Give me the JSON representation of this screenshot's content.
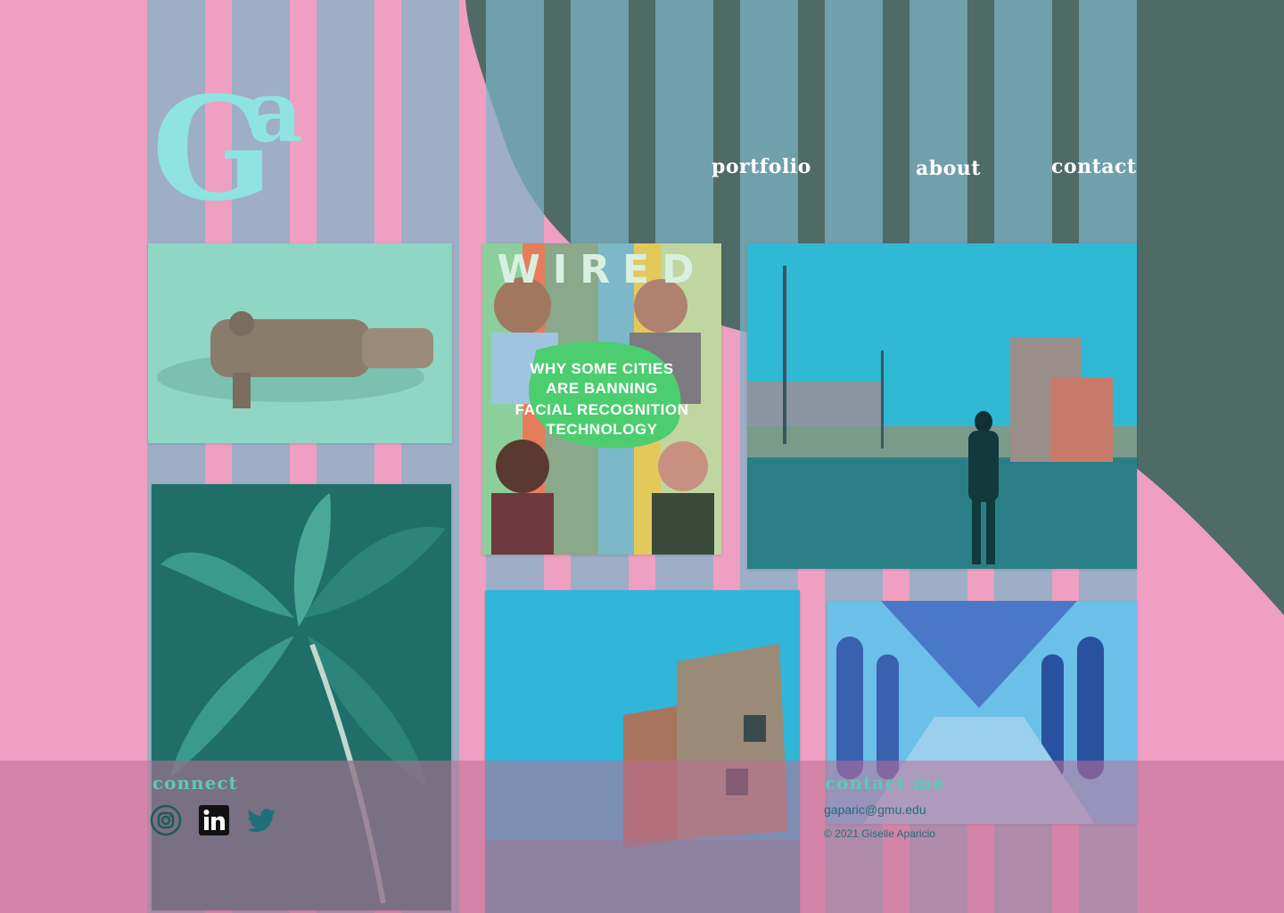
{
  "brand": {
    "logo_text": "Ga",
    "owner": "Giselle Aparicio"
  },
  "nav": {
    "items": [
      {
        "label": "portfolio"
      },
      {
        "label": "about"
      },
      {
        "label": "contact"
      }
    ]
  },
  "portfolio": {
    "tiles": [
      {
        "name": "metal-object-photo"
      },
      {
        "name": "wired-magazine-cover",
        "masthead": "WIRED",
        "headline_lines": [
          "WHY SOME CITIES",
          "ARE BANNING",
          "FACIAL RECOGNITION",
          "TECHNOLOGY"
        ]
      },
      {
        "name": "person-walking-photo"
      },
      {
        "name": "plant-leaves-photo"
      },
      {
        "name": "brick-building-photo"
      },
      {
        "name": "arched-corridor-illustration"
      }
    ]
  },
  "footer": {
    "connect_heading": "connect",
    "social": [
      {
        "icon": "instagram-icon"
      },
      {
        "icon": "linkedin-icon"
      },
      {
        "icon": "twitter-icon"
      }
    ],
    "contact_heading": "contact me",
    "email": "gaparic@gmu.edu",
    "copyright": "© 2021 Giselle Aparicio"
  },
  "colors": {
    "background_pink": "#ef9fc1",
    "dark_teal": "#4f6b66",
    "stripe_blue": "#7db4c8",
    "accent_teal": "#8fe3e0"
  }
}
